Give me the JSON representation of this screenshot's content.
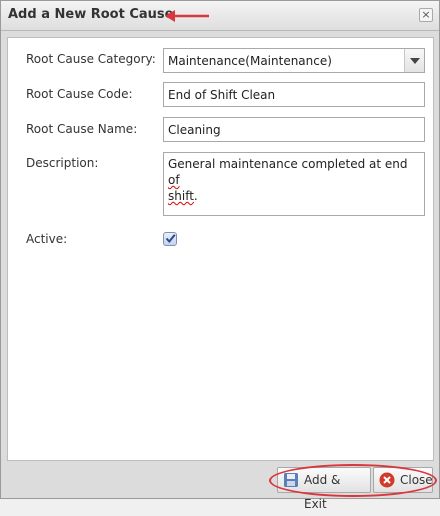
{
  "dialog": {
    "title": "Add a New Root Cause",
    "close_glyph": "×"
  },
  "form": {
    "category_label": "Root Cause Category:",
    "category_value": "Maintenance(Maintenance)",
    "code_label": "Root Cause Code:",
    "code_value": "End of Shift Clean",
    "name_label": "Root Cause Name:",
    "name_value": "Cleaning",
    "description_label": "Description:",
    "description_part1": "General maintenance completed at end ",
    "description_of": "of",
    "description_shift": "shift",
    "description_end": ".",
    "active_label": "Active:",
    "active_checked": true
  },
  "footer": {
    "add_exit_label": "Add & Exit",
    "close_label": "Close"
  },
  "annotations": {
    "highlight_color": "#d9363e"
  },
  "icons": {
    "add_exit": "save-disk-icon",
    "close": "red-x-circle-icon",
    "active": "checkmark-icon"
  }
}
